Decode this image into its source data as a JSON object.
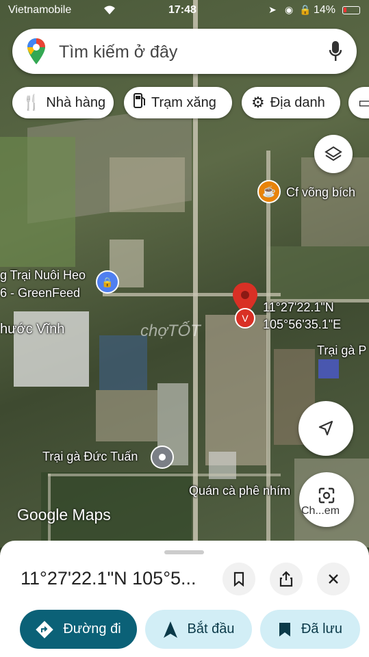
{
  "status": {
    "carrier": "Vietnamobile",
    "time": "17:48",
    "battery": "14%"
  },
  "search": {
    "placeholder": "Tìm kiếm ở đây",
    "logo_icon": "maps-pin-logo-icon",
    "mic_icon": "microphone-icon"
  },
  "chips": [
    {
      "label": "Nhà hàng",
      "icon": "fork-knife-icon"
    },
    {
      "label": "Trạm xăng",
      "icon": "gas-pump-icon"
    },
    {
      "label": "Địa danh",
      "icon": "landmark-icon"
    }
  ],
  "map": {
    "places": {
      "cafe": "Cf võng bích",
      "farm_line1": "g Trại Nuôi Heo",
      "farm_line2": "6 - GreenFeed",
      "village": "hước Vĩnh",
      "chicken_farm_right": "Trại gà P",
      "chicken_farm": "Trại gà Đức Tuấn",
      "coffee_shop": "Quán cà phê nhím"
    },
    "pin_coords_line1": "11°27'22.1\"N",
    "pin_coords_line2": "105°56'35.1\"E",
    "watermark": "Google Maps",
    "chotot": "chợTỐT",
    "lens_label": "Ch...em"
  },
  "sheet": {
    "title": "11°27'22.1\"N 105°5...",
    "buttons": {
      "directions": "Đường đi",
      "start": "Bắt đầu",
      "saved": "Đã lưu"
    }
  },
  "colors": {
    "accent_teal": "#0b6177",
    "light_teal": "#d2eef6",
    "pin_red": "#d93025",
    "poi_blue": "#4f7ff0",
    "poi_orange": "#e8830a",
    "poi_gray": "#7b7f86"
  }
}
